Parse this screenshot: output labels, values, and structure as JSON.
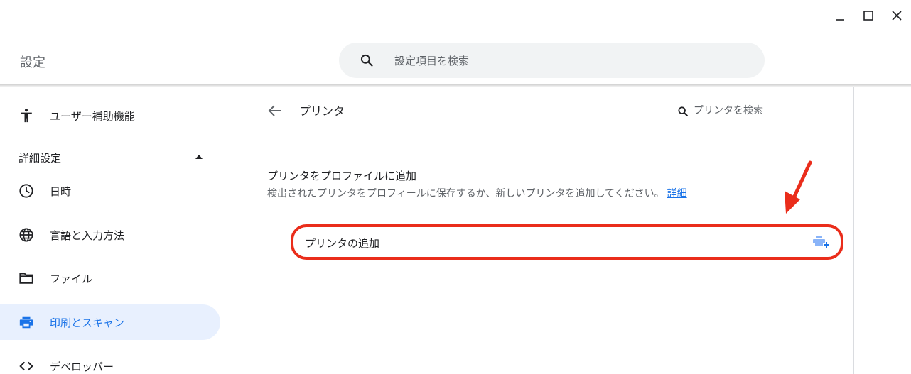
{
  "app": {
    "title": "設定"
  },
  "search": {
    "placeholder": "設定項目を検索"
  },
  "sidebar": {
    "items": [
      {
        "label": "ユーザー補助機能",
        "icon": "accessibility-icon"
      },
      {
        "label": "日時",
        "icon": "clock-icon"
      },
      {
        "label": "言語と入力方法",
        "icon": "globe-icon"
      },
      {
        "label": "ファイル",
        "icon": "folder-icon"
      },
      {
        "label": "印刷とスキャン",
        "icon": "printer-icon",
        "active": true
      },
      {
        "label": "デベロッパー",
        "icon": "code-icon"
      }
    ],
    "section_label": "詳細設定"
  },
  "main": {
    "title": "プリンタ",
    "printer_search_placeholder": "プリンタを検索",
    "section_heading": "プリンタをプロファイルに追加",
    "section_desc": "検出されたプリンタをプロフィールに保存するか、新しいプリンタを追加してください。",
    "learn_more": "詳細",
    "add_printer_label": "プリンタの追加"
  },
  "colors": {
    "accent": "#1a73e8",
    "active_bg": "#e8f0fe",
    "annotation": "#ea2d1b"
  }
}
